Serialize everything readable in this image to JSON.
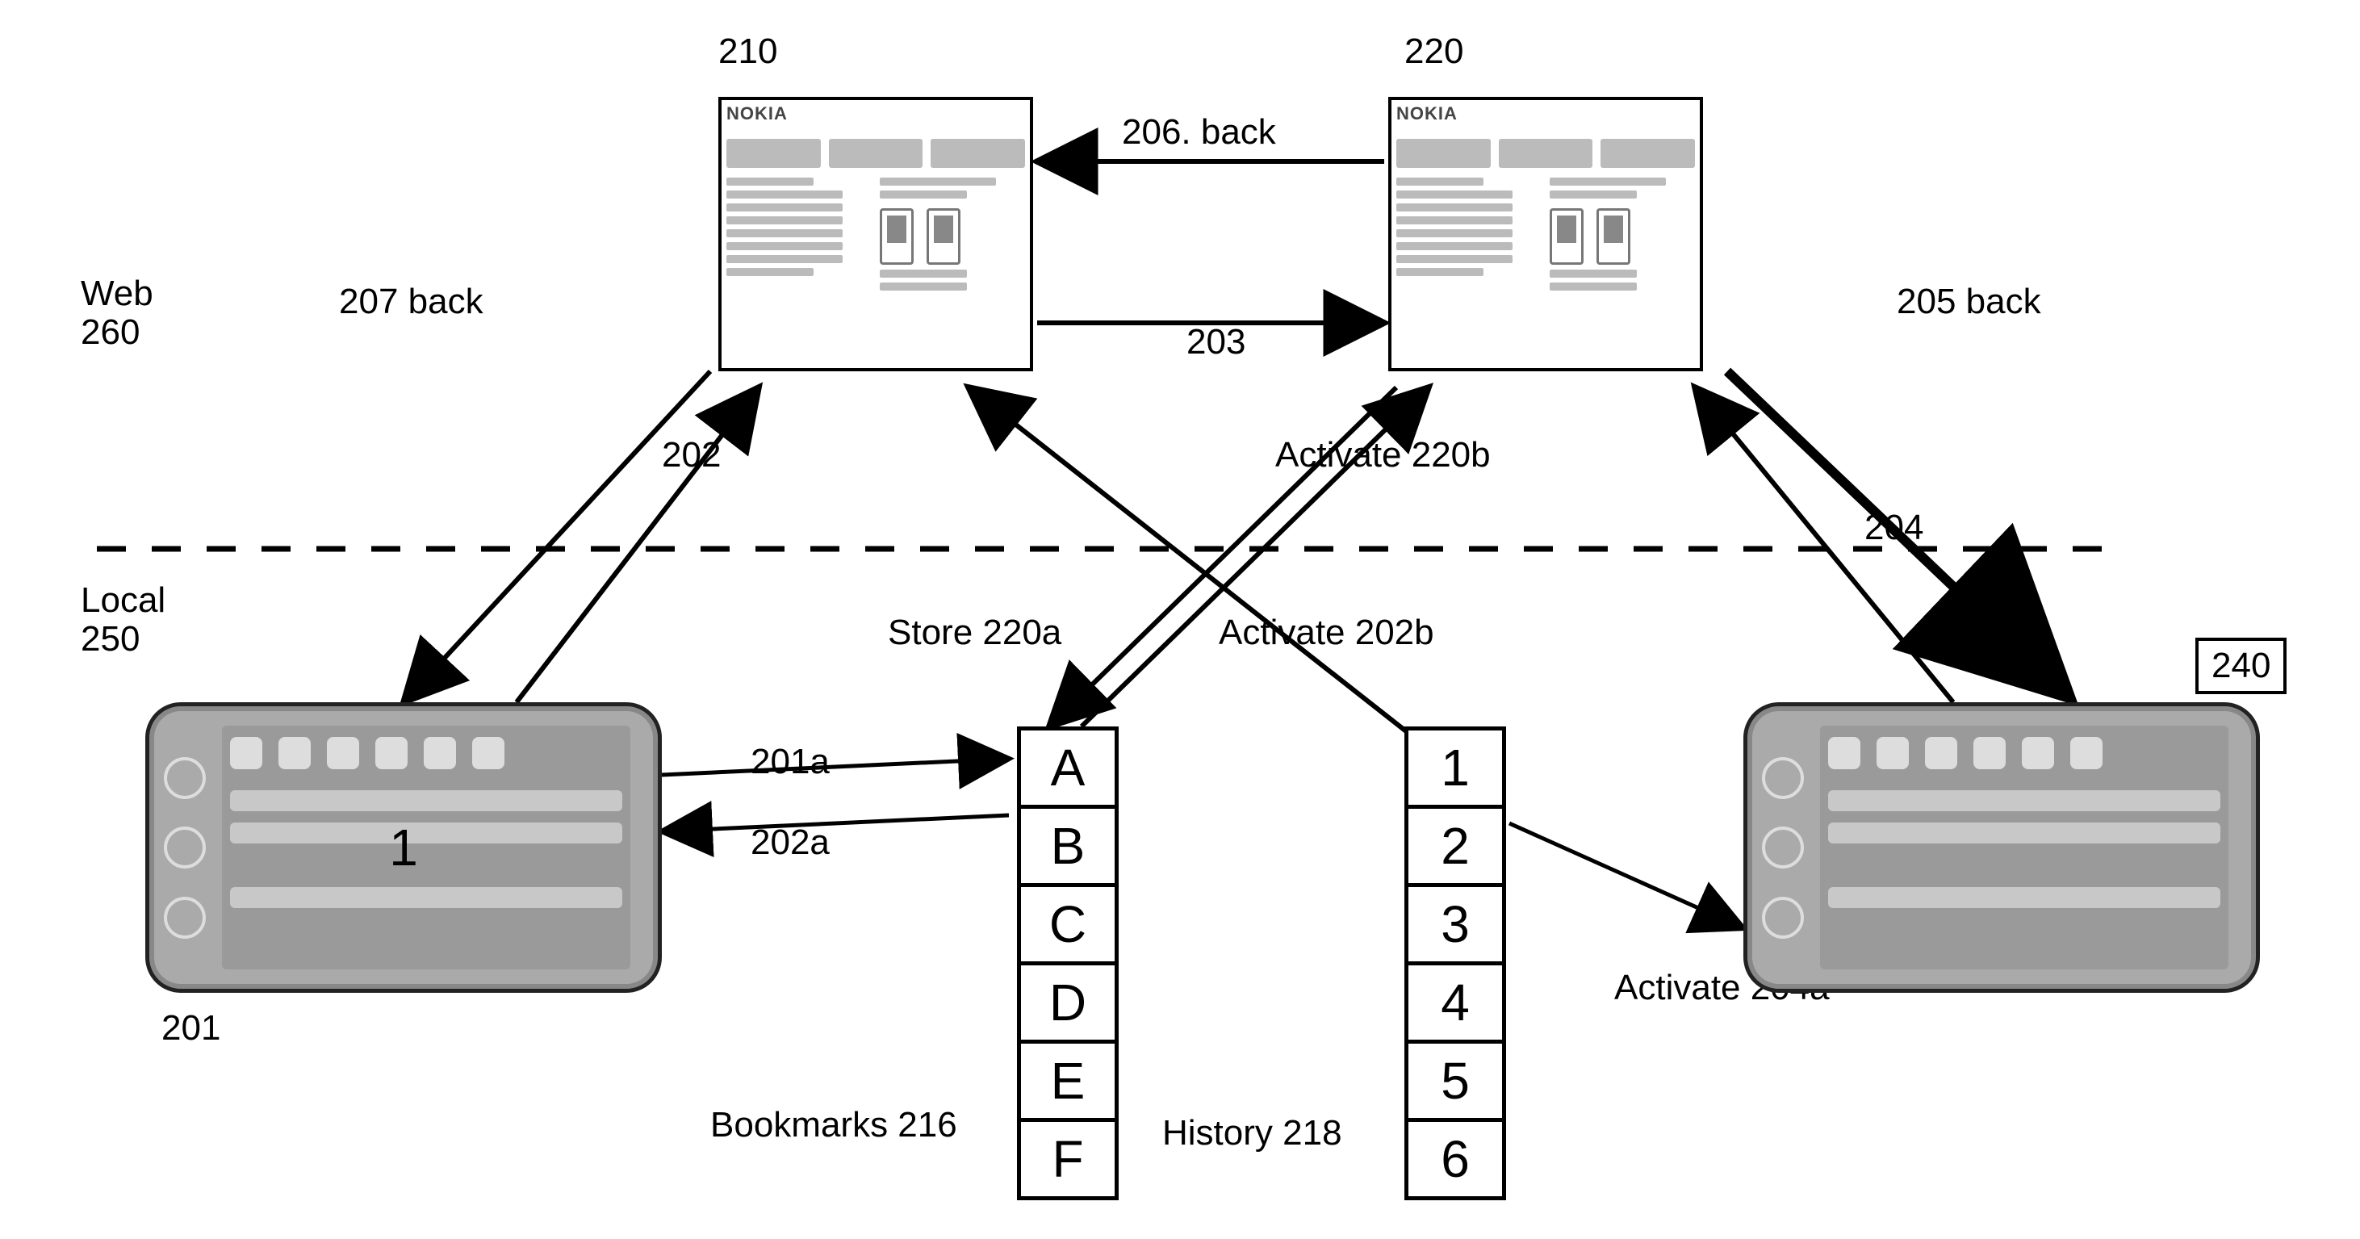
{
  "regions": {
    "web_label": "Web 260",
    "local_label": "Local 250"
  },
  "webpages": {
    "left_ref": "210",
    "left_brand": "NOKIA",
    "right_ref": "220",
    "right_brand": "NOKIA"
  },
  "phones": {
    "left_ref": "201",
    "left_center": "1",
    "right_ref": "240"
  },
  "stacks": {
    "bookmarks_label": "Bookmarks 216",
    "bookmarks_items": [
      "A",
      "B",
      "C",
      "D",
      "E",
      "F"
    ],
    "history_label": "History 218",
    "history_items": [
      "1",
      "2",
      "3",
      "4",
      "5",
      "6"
    ]
  },
  "arrows": {
    "a202": "202",
    "a207_back": "207 back",
    "a203": "203",
    "a206_back": "206. back",
    "a201a": "201a",
    "a202a": "202a",
    "store_220a": "Store 220a",
    "activate_220b": "Activate 220b",
    "activate_202b": "Activate 202b",
    "activate_204a": "Activate 204a",
    "a204": "204",
    "a205_back": "205 back"
  }
}
